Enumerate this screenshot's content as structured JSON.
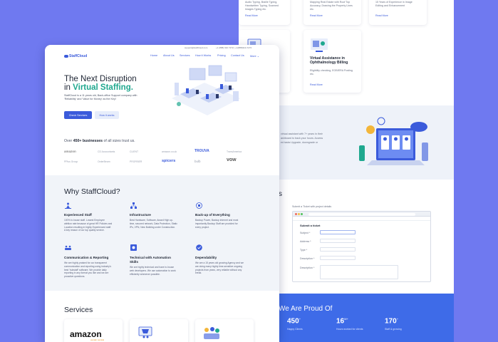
{
  "back": {
    "cards_top": [
      {
        "text": "Audio Typing, Braille Typing, Handwritten Typing, Scanned Images Typing etc.",
        "read_more": "Read More"
      },
      {
        "text": "Mapping Real Estate with Roof Top Accuracy, Drawing the Property Lines etc.",
        "read_more": "Read More"
      },
      {
        "text": "15 Years of Experience in Image Editing and Enhancement",
        "read_more": "Read More"
      }
    ],
    "card_ophth": {
      "title": "Virtual Assistance in Ophthalmology Billing",
      "desc": "Eligibility checking, EOB/ERA Posting etc.",
      "read_more": "Read More"
    },
    "wb": {
      "title_fragment": "ing",
      "lines": [
        "virtual assistant with 7+ years in their",
        "ashboard to track your hours. Access",
        "ed tasks Upgrade, downgrade or"
      ]
    },
    "ticket": {
      "heading_fragment": "s",
      "subtext": "Submit a Ticket with project details",
      "form_title": "Submit a ticket",
      "fields": [
        "Subject *",
        "Address *",
        "Type *",
        "Description *",
        "Description *"
      ]
    },
    "proud": {
      "title": "We Are Proud Of",
      "stats": [
        {
          "num": "450",
          "suffix": "+",
          "label": "Happy Clients"
        },
        {
          "num": "16",
          "suffix": "M+",
          "label": "Hours worked for clients"
        },
        {
          "num": "170",
          "suffix": "+",
          "label": "Staff & growing"
        }
      ]
    }
  },
  "front": {
    "topbar": {
      "email": "support@staffcloud.com",
      "phone": "+1 (888) 910 7272 | +1(888)910-7272"
    },
    "logo": "StaffCloud",
    "nav": [
      "Home",
      "About Us",
      "Services",
      "How it Works",
      "Pricing",
      "Contact Us",
      "More"
    ],
    "hero": {
      "title_line1": "The Next Disruption",
      "title_in": "in ",
      "title_accent": "Virtual Staffing.",
      "desc": "StaffCloud is a 11 years old, Back-office Support company with 'Reliability' and 'Value for Money' as the Key!",
      "btn_primary": "Check Services",
      "btn_secondary": "How it works"
    },
    "trust": {
      "prefix": "Over ",
      "bold": "450+ businesses",
      "suffix": " of all sizes trust us."
    },
    "clients": [
      "amazon",
      "CD Accountants",
      "CLIENT",
      "amazon.co.uk",
      "TROUVA",
      "TransAmerica",
      "PPlus Group",
      "OrderBeam",
      "PROFIBER",
      "spicers",
      "bulb",
      "vow"
    ],
    "why": {
      "title": "Why StaffCloud?",
      "features": [
        {
          "title": "Experienced Staff",
          "desc": "100% in-house staff. Lowest Employee attrition rate because of great HR Policies and Location resulting in highly Experienced staff. A key reason of our top quality service."
        },
        {
          "title": "Infrastructure",
          "desc": "Best Hardware, Software, Award High up-time, secured network, Data Protection, Static IPs, VPN, New Building under Construction."
        },
        {
          "title": "Back-up of Everything",
          "desc": "Backup Power, Backup internet and most importantly Backup Staff are provided for every project."
        },
        {
          "title": "Communication & Reporting",
          "desc": "We are highly praised for our transparent communication and reporting using industry's best 'hubstaff' software. We provide daily reporting in any format you like and we are proactive questions."
        },
        {
          "title": "Technical with Automation Skills",
          "desc": "We are highly technical and have in-house web developers. We use automation to work efficiently whenever possible."
        },
        {
          "title": "Dependability",
          "desc": "We are a 15 years old growing Agency and we are doing many highly time-sensitive ongoing projects from years, very reliable without any break."
        }
      ]
    },
    "services": {
      "title": "Services",
      "amazon_logo": "amazon",
      "amazon_sub": "vendor central"
    }
  },
  "colors": {
    "accent": "#3b5bdb",
    "teal": "#1fa88f",
    "bg": "#6f79f0",
    "band": "#3e6be8"
  }
}
